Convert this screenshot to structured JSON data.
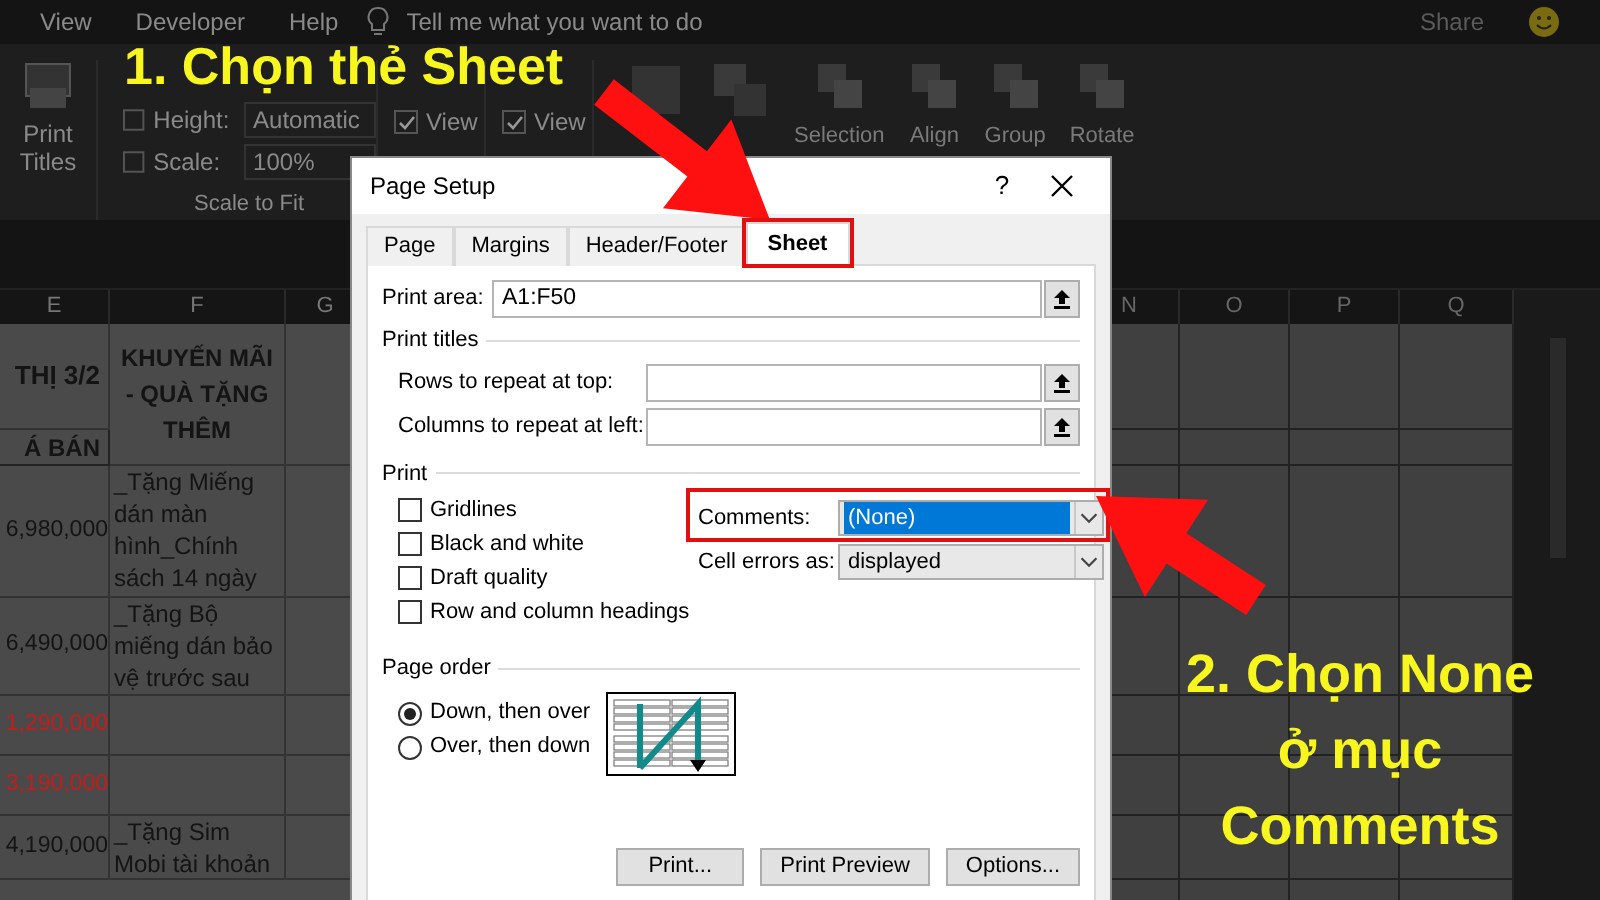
{
  "menu_bar": {
    "items": [
      "View",
      "Developer",
      "Help"
    ],
    "search": "Tell me what you want to do",
    "share": "Share"
  },
  "ribbon": {
    "print_titles": "Print Titles",
    "height": {
      "label": "Height:",
      "value": "Automatic"
    },
    "scale": {
      "label": "Scale:",
      "value": "100%"
    },
    "group_label": "Scale to Fit",
    "sheet_options": [
      {
        "view": "View",
        "checked": true
      },
      {
        "view": "View",
        "checked": true
      }
    ],
    "arrange": [
      "Selection",
      "Align",
      "Group",
      "Rotate"
    ]
  },
  "sheet": {
    "left_columns": [
      "E",
      "F",
      "G"
    ],
    "right_columns": [
      "N",
      "O",
      "P",
      "Q"
    ],
    "header": {
      "e_top": "THỊ 3/2",
      "e_bottom": "Á BÁN",
      "f": "KHUYẾN MÃI - QUÀ TẶNG THÊM"
    },
    "rows": [
      {
        "e": "6,980,000",
        "f": "_Tặng Miếng dán màn hình_Chính sách 14 ngày"
      },
      {
        "e": "6,490,000",
        "f": "_Tặng Bộ miếng dán bảo vệ trước sau"
      },
      {
        "e": "1,290,000",
        "color": "#c41c1c"
      },
      {
        "e": "3,190,000",
        "color": "#c41c1c"
      },
      {
        "e": "4,190,000",
        "f": "_Tặng Sim Mobi tài khoản"
      }
    ]
  },
  "dialog": {
    "title": "Page Setup",
    "help": "?",
    "tabs": [
      {
        "label": "Page",
        "selected": false
      },
      {
        "label": "Margins",
        "selected": false
      },
      {
        "label": "Header/Footer",
        "selected": false
      },
      {
        "label": "Sheet",
        "selected": true
      }
    ],
    "print_area": {
      "label": "Print area:",
      "value": "A1:F50"
    },
    "print_titles": {
      "title": "Print titles",
      "rows_label": "Rows to repeat at top:",
      "columns_label": "Columns to repeat at left:"
    },
    "print": {
      "title": "Print",
      "options": [
        {
          "label": "Gridlines",
          "checked": false
        },
        {
          "label": "Black and white",
          "checked": false
        },
        {
          "label": "Draft quality",
          "checked": false
        },
        {
          "label": "Row and column headings",
          "checked": false
        }
      ],
      "comments": {
        "label": "Comments:",
        "value": "(None)"
      },
      "cell_errors": {
        "label": "Cell errors as:",
        "value": "displayed"
      }
    },
    "page_order": {
      "title": "Page order",
      "options": [
        {
          "label": "Down, then over",
          "selected": true
        },
        {
          "label": "Over, then down",
          "selected": false
        }
      ]
    },
    "buttons": [
      "Print...",
      "Print Preview",
      "Options..."
    ]
  },
  "annotations": [
    "1. Chọn thẻ Sheet",
    "2. Chọn None ở mục Comments"
  ]
}
